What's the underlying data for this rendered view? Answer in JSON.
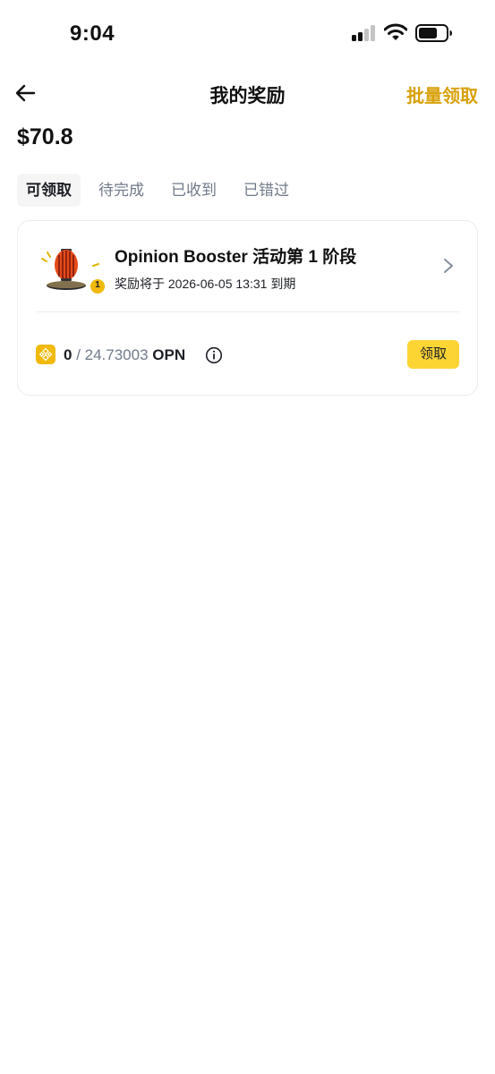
{
  "status_bar": {
    "time": "9:04",
    "icons": [
      "signal-icon",
      "wifi-icon",
      "battery-icon"
    ]
  },
  "header": {
    "title": "我的奖励",
    "batch_claim_label": "批量领取",
    "back_icon": "arrow-left-icon"
  },
  "total_value": "$70.8",
  "tabs": [
    {
      "label": "可领取",
      "active": true
    },
    {
      "label": "待完成",
      "active": false
    },
    {
      "label": "已收到",
      "active": false
    },
    {
      "label": "已错过",
      "active": false
    }
  ],
  "reward": {
    "name": "Opinion Booster 活动第 1 阶段",
    "expiry": "奖励将于 2026-06-05 13:31 到期",
    "badge_count": "1",
    "claimed_amount": "0",
    "separator": " / ",
    "total_amount": "24.73003",
    "unit": " OPN",
    "claim_button_label": "领取"
  },
  "colors": {
    "accent_gold": "#d8a10b",
    "button_yellow": "#fcd535",
    "text_primary": "#1e2026",
    "text_secondary": "#707a8a",
    "border": "#eaecef"
  }
}
